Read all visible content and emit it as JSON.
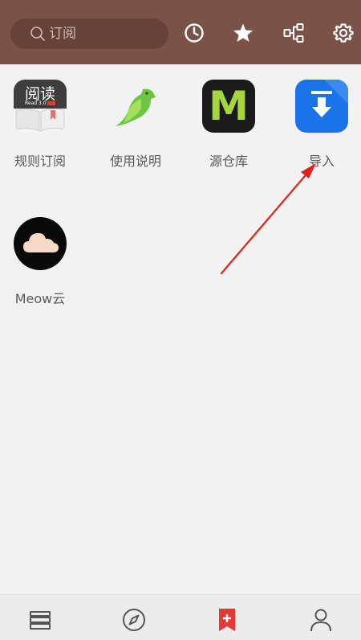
{
  "search": {
    "placeholder": "订阅",
    "value": ""
  },
  "toolbar": {
    "icons": [
      "history-icon",
      "star-icon",
      "tree-structure-icon",
      "settings-icon"
    ]
  },
  "grid": {
    "items": [
      {
        "label": "规则订阅",
        "icon": "legado-read-app-icon",
        "icon_text": "阅读",
        "icon_subtext": "Read 3.0"
      },
      {
        "label": "使用说明",
        "icon": "green-bird-icon"
      },
      {
        "label": "源仓库",
        "icon": "m-logo-icon",
        "icon_text": "M"
      },
      {
        "label": "导入",
        "icon": "import-download-icon"
      },
      {
        "label": "Meow云",
        "icon": "cloud-icon"
      }
    ]
  },
  "bottom_nav": {
    "items": [
      "bookshelf-icon",
      "compass-icon",
      "bookmark-add-icon",
      "profile-icon"
    ],
    "active_index": 2
  },
  "colors": {
    "topbar": "#7a5248",
    "search_bg": "#684139",
    "accent_red": "#e53935",
    "import_blue": "#1a73e8",
    "m_green": "#a6d63c"
  }
}
